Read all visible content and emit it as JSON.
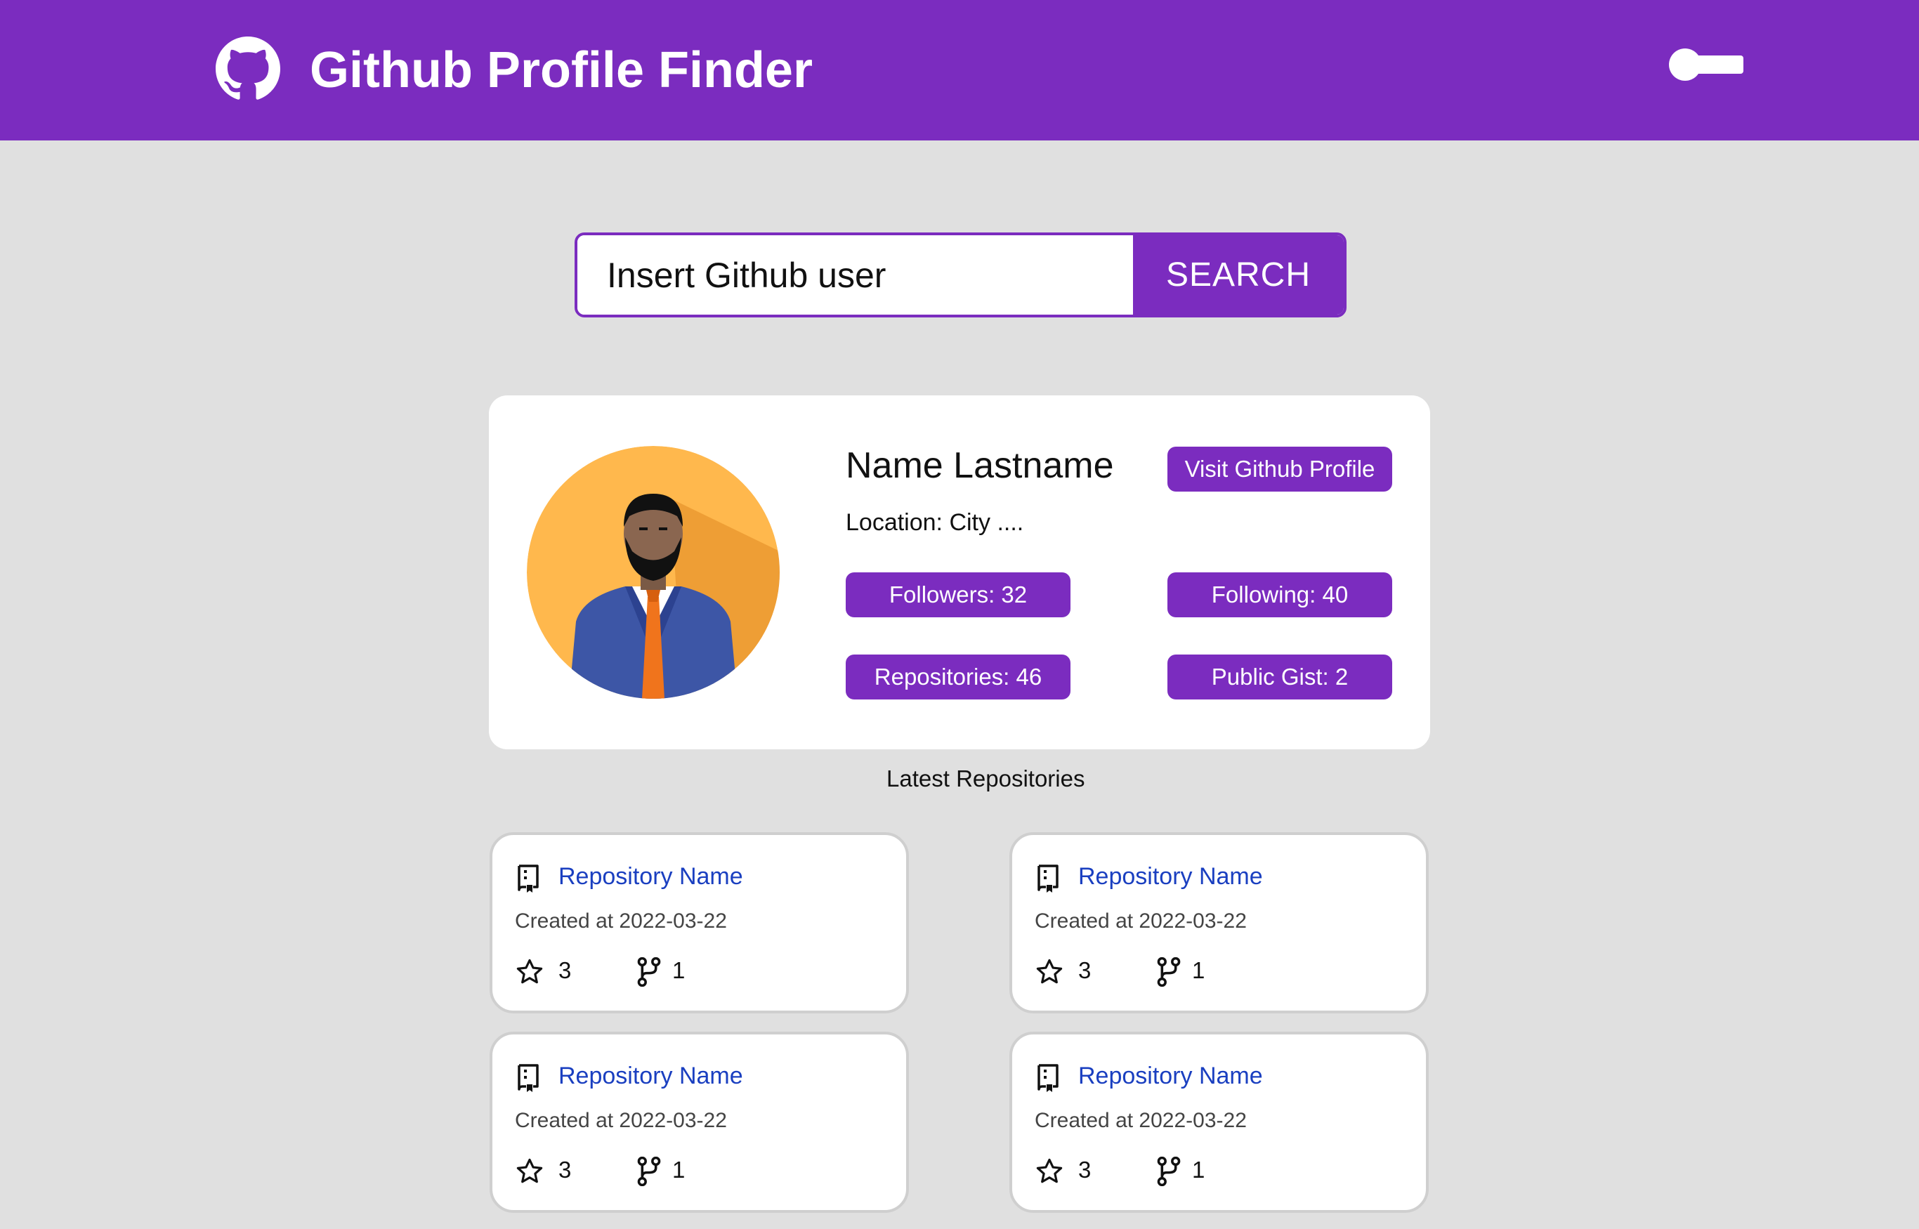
{
  "header": {
    "title": "Github Profile Finder",
    "logo_icon": "github-octocat-icon",
    "theme_toggle_icon": "toggle-icon",
    "background": "#7b2cbf"
  },
  "search": {
    "placeholder": "Insert Github user",
    "button_label": "SEARCH"
  },
  "profile": {
    "name": "Name Lastname",
    "location_label": "Location:",
    "location_value": "City ....",
    "visit_button": "Visit Github Profile",
    "followers": "Followers: 32",
    "following": "Following: 40",
    "repositories": "Repositories: 46",
    "public_gist": "Public Gist: 2"
  },
  "latest_heading": "Latest Repositories",
  "repos": [
    {
      "name": "Repository Name",
      "created": "Created at 2022-03-22",
      "stars": "3",
      "forks": "1"
    },
    {
      "name": "Repository Name",
      "created": "Created at 2022-03-22",
      "stars": "3",
      "forks": "1"
    },
    {
      "name": "Repository Name",
      "created": "Created at 2022-03-22",
      "stars": "3",
      "forks": "1"
    },
    {
      "name": "Repository Name",
      "created": "Created at 2022-03-22",
      "stars": "3",
      "forks": "1"
    }
  ],
  "colors": {
    "accent": "#7b2cbf",
    "link": "#1a3fc0",
    "background": "#e0e0e0",
    "avatar_bg": "#ffb84d"
  }
}
